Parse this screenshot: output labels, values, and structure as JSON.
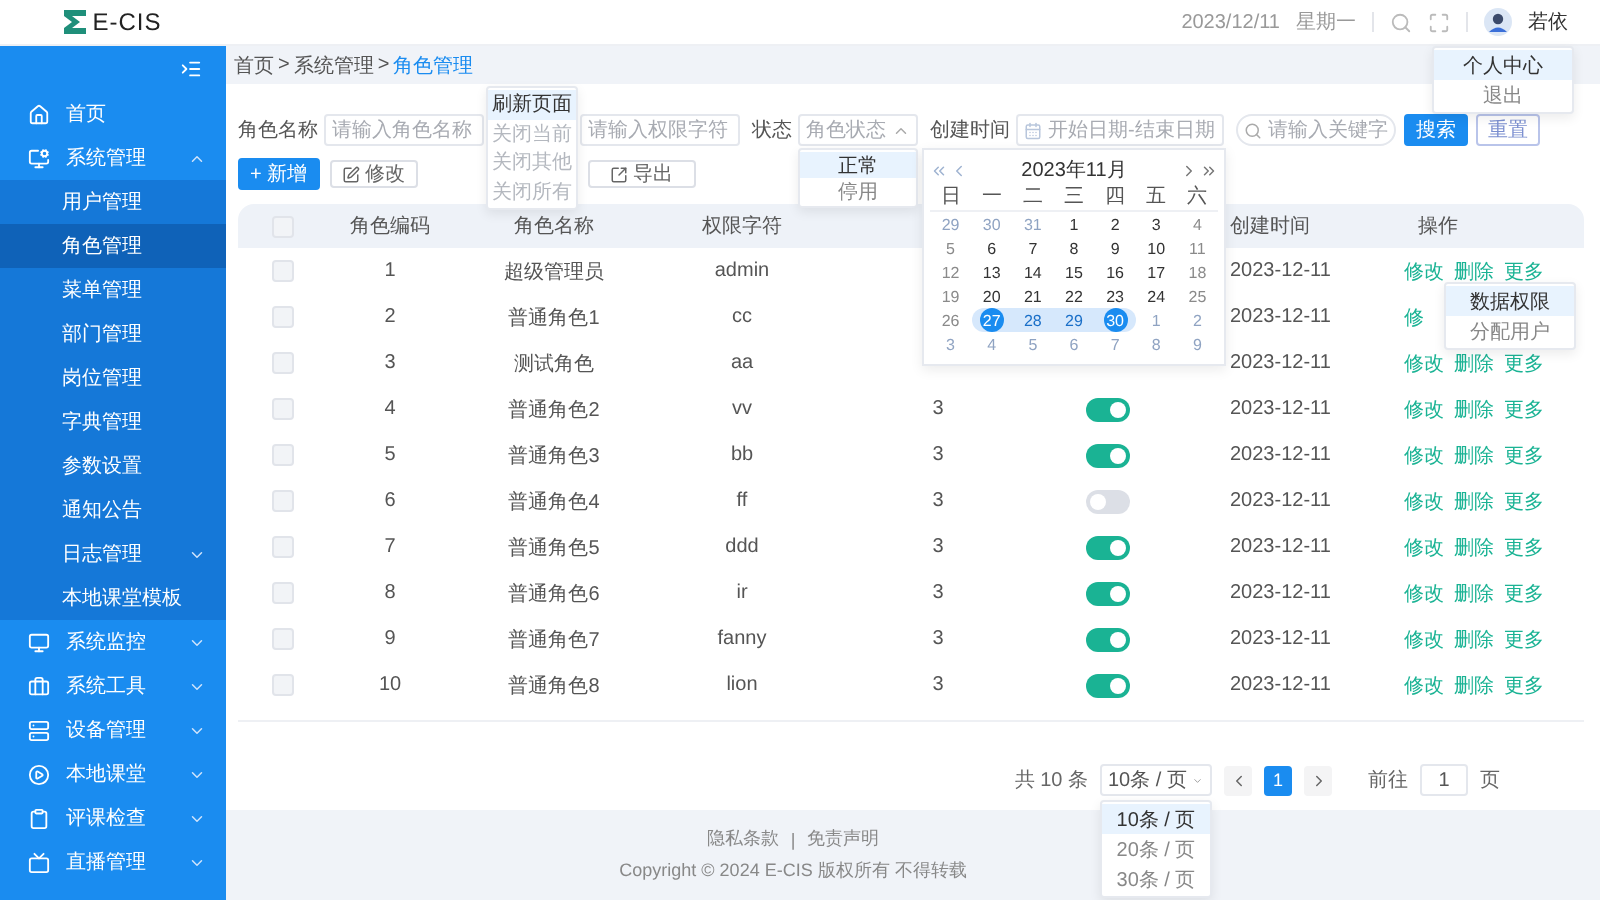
{
  "header": {
    "logo": "E-CIS",
    "date": "2023/12/11",
    "weekday": "星期一",
    "user": "若依"
  },
  "user_menu": [
    {
      "label": "个人中心",
      "selected": true
    },
    {
      "label": "退出",
      "selected": false
    }
  ],
  "sidebar": {
    "items": [
      {
        "label": "首页"
      },
      {
        "label": "系统管理",
        "expanded": true,
        "children": [
          {
            "label": "用户管理",
            "selected": false
          },
          {
            "label": "角色管理",
            "selected": true
          },
          {
            "label": "菜单管理",
            "selected": false
          },
          {
            "label": "部门管理",
            "selected": false
          },
          {
            "label": "岗位管理",
            "selected": false
          },
          {
            "label": "字典管理",
            "selected": false
          },
          {
            "label": "参数设置",
            "selected": false
          },
          {
            "label": "通知公告",
            "selected": false
          },
          {
            "label": "日志管理",
            "selected": false,
            "expanded": false
          },
          {
            "label": "本地课堂模板",
            "selected": false
          }
        ]
      },
      {
        "label": "系统监控",
        "expanded": false
      },
      {
        "label": "系统工具",
        "expanded": false
      },
      {
        "label": "设备管理",
        "expanded": false
      },
      {
        "label": "本地课堂",
        "expanded": false
      },
      {
        "label": "评课检查",
        "expanded": false
      },
      {
        "label": "直播管理",
        "expanded": false
      }
    ]
  },
  "breadcrumb": {
    "separator": ">",
    "items": [
      "首页",
      "系统管理",
      "角色管理"
    ]
  },
  "tab_menu": [
    {
      "label": "刷新页面",
      "selected": true,
      "disabled": false
    },
    {
      "label": "关闭当前",
      "selected": false,
      "disabled": true
    },
    {
      "label": "关闭其他",
      "selected": false,
      "disabled": true
    },
    {
      "label": "关闭所有",
      "selected": false,
      "disabled": true
    }
  ],
  "filters": [
    {
      "kind": "text",
      "label": "角色名称",
      "placeholder": "请输入角色名称"
    },
    {
      "kind": "text",
      "placeholder": "请输入权限字符"
    },
    {
      "kind": "select",
      "label": "状态",
      "placeholder": "角色状态",
      "expanded": true
    },
    {
      "kind": "date",
      "label": "创建时间",
      "placeholder": "开始日期-结束日期"
    }
  ],
  "keyword": {
    "placeholder": "请输入关键字"
  },
  "search_buttons": [
    {
      "label": "搜索",
      "kind": "primary"
    },
    {
      "label": "重置",
      "kind": "plain"
    }
  ],
  "toolbar": [
    {
      "label": "+ 新增",
      "kind": "primary"
    },
    {
      "label": "修改",
      "kind": "edit"
    },
    {
      "label": "导出",
      "kind": "export"
    }
  ],
  "status_options": [
    {
      "label": "正常",
      "selected": true
    },
    {
      "label": "停用",
      "selected": false
    }
  ],
  "calendar": {
    "title": "2023年11月",
    "weekdays": [
      "日",
      "一",
      "二",
      "三",
      "四",
      "五",
      "六"
    ],
    "weeks": [
      [
        {
          "day": "29",
          "kind": "other"
        },
        {
          "day": "30",
          "kind": "other"
        },
        {
          "day": "31",
          "kind": "other"
        },
        {
          "day": "1",
          "kind": "current"
        },
        {
          "day": "2",
          "kind": "current"
        },
        {
          "day": "3",
          "kind": "current"
        },
        {
          "day": "4",
          "kind": "current"
        }
      ],
      [
        {
          "day": "5",
          "kind": "current"
        },
        {
          "day": "6",
          "kind": "current"
        },
        {
          "day": "7",
          "kind": "current"
        },
        {
          "day": "8",
          "kind": "current"
        },
        {
          "day": "9",
          "kind": "current"
        },
        {
          "day": "10",
          "kind": "current"
        },
        {
          "day": "11",
          "kind": "current"
        }
      ],
      [
        {
          "day": "12",
          "kind": "current"
        },
        {
          "day": "13",
          "kind": "current"
        },
        {
          "day": "14",
          "kind": "current"
        },
        {
          "day": "15",
          "kind": "current"
        },
        {
          "day": "16",
          "kind": "current"
        },
        {
          "day": "17",
          "kind": "current"
        },
        {
          "day": "18",
          "kind": "current"
        }
      ],
      [
        {
          "day": "19",
          "kind": "current"
        },
        {
          "day": "20",
          "kind": "current"
        },
        {
          "day": "21",
          "kind": "current"
        },
        {
          "day": "22",
          "kind": "current"
        },
        {
          "day": "23",
          "kind": "current"
        },
        {
          "day": "24",
          "kind": "current"
        },
        {
          "day": "25",
          "kind": "current"
        }
      ],
      [
        {
          "day": "26",
          "kind": "current"
        },
        {
          "day": "27",
          "kind": "start"
        },
        {
          "day": "28",
          "kind": "in"
        },
        {
          "day": "29",
          "kind": "in"
        },
        {
          "day": "30",
          "kind": "end"
        },
        {
          "day": "1",
          "kind": "other"
        },
        {
          "day": "2",
          "kind": "other"
        }
      ],
      [
        {
          "day": "3",
          "kind": "other"
        },
        {
          "day": "4",
          "kind": "other"
        },
        {
          "day": "5",
          "kind": "other"
        },
        {
          "day": "6",
          "kind": "other"
        },
        {
          "day": "7",
          "kind": "other"
        },
        {
          "day": "8",
          "kind": "other"
        },
        {
          "day": "9",
          "kind": "other"
        }
      ]
    ]
  },
  "table": {
    "all_checked": false,
    "columns": [
      "角色编码",
      "角色名称",
      "权限字符",
      "创建时间",
      "操作"
    ],
    "rows": [
      {
        "checked": false,
        "code": "1",
        "name": "超级管理员",
        "key": "admin",
        "created": "2023-12-11",
        "actions": [
          "修改",
          "删除",
          "更多"
        ]
      },
      {
        "checked": false,
        "code": "2",
        "name": "普通角色1",
        "key": "cc",
        "created": "2023-12-11",
        "actions": [
          "修"
        ]
      },
      {
        "checked": false,
        "code": "3",
        "name": "测试角色",
        "key": "aa",
        "created": "2023-12-11",
        "actions": [
          "修改",
          "删除",
          "更多"
        ]
      },
      {
        "checked": false,
        "code": "4",
        "name": "普通角色2",
        "key": "vv",
        "column_4": "3",
        "on": true,
        "created": "2023-12-11",
        "actions": [
          "修改",
          "删除",
          "更多"
        ]
      },
      {
        "checked": false,
        "code": "5",
        "name": "普通角色3",
        "key": "bb",
        "column_4": "3",
        "on": true,
        "created": "2023-12-11",
        "actions": [
          "修改",
          "删除",
          "更多"
        ]
      },
      {
        "checked": false,
        "code": "6",
        "name": "普通角色4",
        "key": "ff",
        "column_4": "3",
        "on": false,
        "created": "2023-12-11",
        "actions": [
          "修改",
          "删除",
          "更多"
        ]
      },
      {
        "checked": false,
        "code": "7",
        "name": "普通角色5",
        "key": "ddd",
        "column_4": "3",
        "on": true,
        "created": "2023-12-11",
        "actions": [
          "修改",
          "删除",
          "更多"
        ]
      },
      {
        "checked": false,
        "code": "8",
        "name": "普通角色6",
        "key": "ir",
        "column_4": "3",
        "on": true,
        "created": "2023-12-11",
        "actions": [
          "修改",
          "删除",
          "更多"
        ]
      },
      {
        "checked": false,
        "code": "9",
        "name": "普通角色7",
        "key": "fanny",
        "column_4": "3",
        "on": true,
        "created": "2023-12-11",
        "actions": [
          "修改",
          "删除",
          "更多"
        ]
      },
      {
        "checked": false,
        "code": "10",
        "name": "普通角色8",
        "key": "lion",
        "column_4": "3",
        "on": true,
        "created": "2023-12-11",
        "actions": [
          "修改",
          "删除",
          "更多"
        ]
      }
    ]
  },
  "row_menu": [
    {
      "label": "数据权限",
      "selected": true
    },
    {
      "label": "分配用户",
      "selected": false
    }
  ],
  "pagination": {
    "total": "共 10 条",
    "page_size": "10条 / 页",
    "pages": [
      {
        "label": "1",
        "selected": true
      }
    ],
    "goto_label": "前往",
    "goto_value": "1",
    "page_suffix": "页"
  },
  "page_size_options": [
    {
      "label": "10条 / 页",
      "selected": true
    },
    {
      "label": "20条 / 页",
      "selected": false
    },
    {
      "label": "30条 / 页",
      "selected": false
    }
  ],
  "footer": {
    "links": [
      "隐私条款",
      "免责声明"
    ],
    "separator": "|",
    "copyright": "Copyright © 2024 E-CIS 版权所有 不得转载"
  }
}
